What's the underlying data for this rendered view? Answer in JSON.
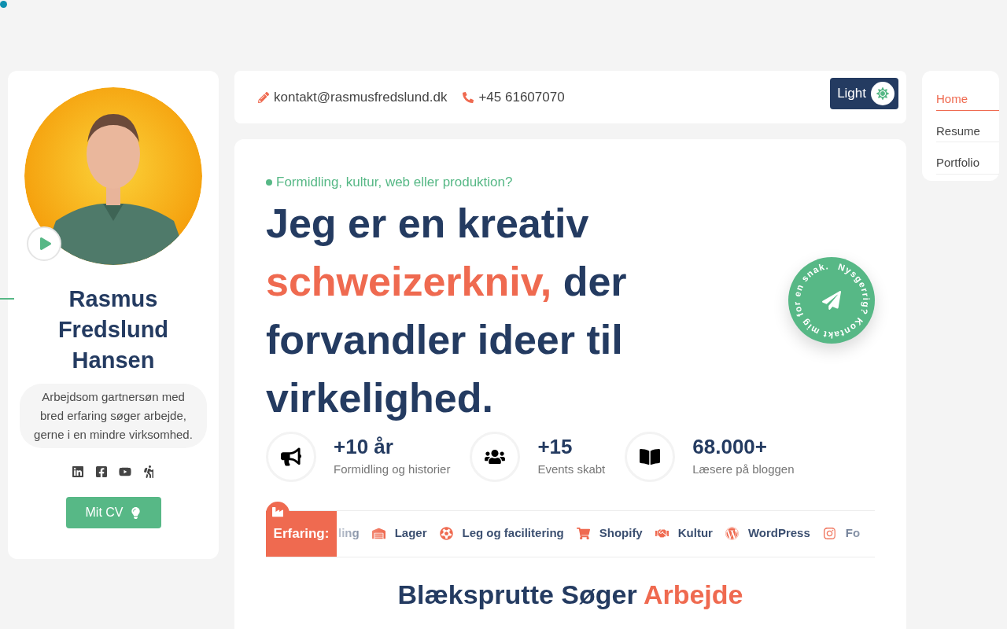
{
  "profile": {
    "name": "Rasmus Fredslund Hansen",
    "bio": "Arbejdsom gartnersøn med bred erfaring søger arbejde, gerne i en mindre virksomhed.",
    "socials": [
      {
        "kind": "linkedin"
      },
      {
        "kind": "facebook"
      },
      {
        "kind": "youtube"
      },
      {
        "kind": "hiking"
      }
    ],
    "cv_button": "Mit CV"
  },
  "contact": {
    "email": "kontakt@rasmusfredslund.dk",
    "phone": "+45 61607070"
  },
  "theme_toggle": {
    "label": "Light"
  },
  "nav": [
    {
      "label": "Home",
      "selected": true
    },
    {
      "label": "Resume",
      "selected": false
    },
    {
      "label": "Portfolio",
      "selected": false
    }
  ],
  "hero": {
    "tagline": "Formidling, kultur, web eller produktion?",
    "heading": [
      {
        "text": "Jeg er en kreativ",
        "accent": false
      },
      {
        "text": "schweizerkniv,",
        "accent": true
      },
      {
        "text": " der forvandler ideer til virkelighed.",
        "accent": false
      }
    ],
    "badge_text": "Nysgerrig? Kontakt mig for en snak. "
  },
  "stats": [
    {
      "kind": "megaphone",
      "value": "+10 år",
      "label": "Formidling og historier"
    },
    {
      "kind": "users",
      "value": "+15",
      "label": "Events skabt"
    },
    {
      "kind": "book",
      "value": "68.000+",
      "label": "Læsere på bloggen"
    }
  ],
  "experience": {
    "label": "Erfaring:",
    "items": [
      {
        "kind": "none",
        "text": "ling"
      },
      {
        "kind": "warehouse",
        "text": "Lager"
      },
      {
        "kind": "ball",
        "text": "Leg og facilitering"
      },
      {
        "kind": "cart",
        "text": "Shopify"
      },
      {
        "kind": "handshake",
        "text": "Kultur"
      },
      {
        "kind": "wordpress",
        "text": "WordPress"
      },
      {
        "kind": "camera",
        "text": "Fo"
      }
    ]
  },
  "section_title": {
    "text": "Blæksprutte Søger",
    "accent": "Arbejde"
  }
}
